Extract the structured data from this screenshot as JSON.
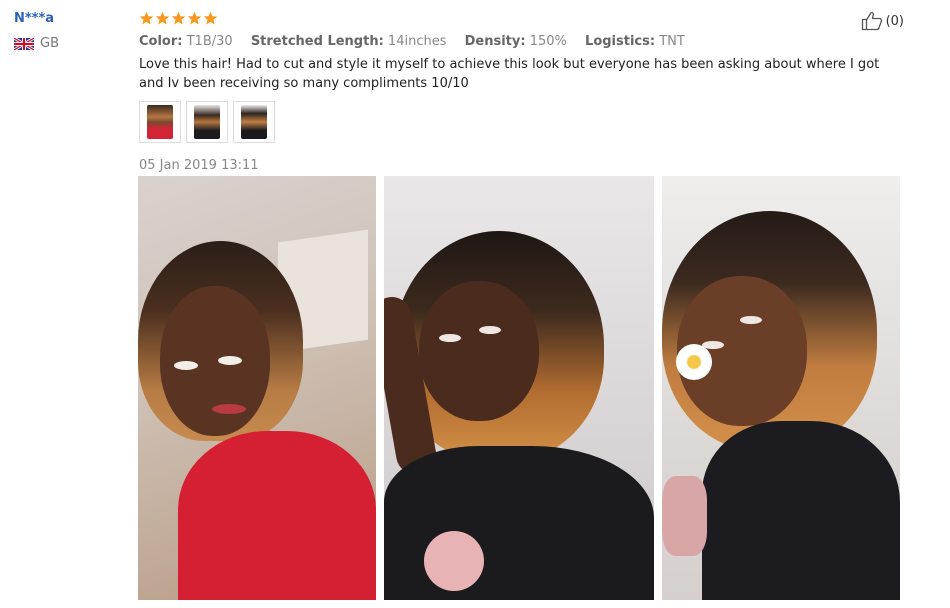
{
  "reviewer": {
    "name": "N***a",
    "country": "GB",
    "flag_icon": "uk-flag-icon"
  },
  "rating": {
    "stars": 5,
    "max": 5,
    "color": "#f79a1e"
  },
  "attributes": [
    {
      "label": "Color:",
      "value": "T1B/30"
    },
    {
      "label": "Stretched Length:",
      "value": "14inches"
    },
    {
      "label": "Density:",
      "value": "150%"
    },
    {
      "label": "Logistics:",
      "value": "TNT"
    }
  ],
  "review_text": "Love this hair! Had to cut and style it myself to achieve this look but everyone has been asking about where I got and Iv been receiving so many compliments 10/10",
  "helpful": {
    "icon": "thumbs-up-icon",
    "count_text": "(0)"
  },
  "date": "05 Jan 2019 13:11",
  "thumbnails": 3,
  "photos": 3
}
